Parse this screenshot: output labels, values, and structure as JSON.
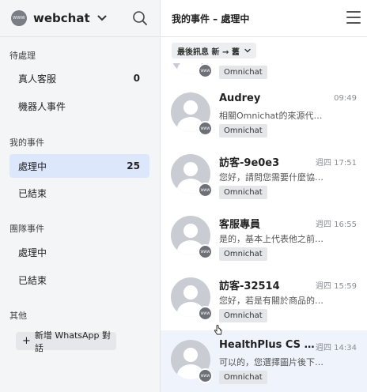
{
  "brand": {
    "logo_text": "WWW",
    "name": "webchat"
  },
  "sidebar": {
    "pending": {
      "title": "待處理",
      "items": [
        {
          "label": "真人客服",
          "count": "0"
        },
        {
          "label": "機器人事件",
          "count": ""
        }
      ]
    },
    "mine": {
      "title": "我的事件",
      "items": [
        {
          "label": "處理中",
          "count": "25",
          "active": true
        },
        {
          "label": "已結束",
          "count": ""
        }
      ]
    },
    "team": {
      "title": "團隊事件",
      "items": [
        {
          "label": "處理中",
          "count": ""
        },
        {
          "label": "已結束",
          "count": ""
        }
      ]
    },
    "other": {
      "title": "其他",
      "whatsapp_button": "新增 WhatsApp 對話"
    }
  },
  "main": {
    "title": "我的事件 – 處理中",
    "sort_label": "最後訊息 新 → 舊",
    "partial_item_tag": "Omnichat",
    "badge_text": "WWW",
    "conversations": [
      {
        "name": "Audrey",
        "time": "09:49",
        "message": "相關Omnichat的來源代…",
        "tag": "Omnichat"
      },
      {
        "name": "訪客-9e0e3",
        "time": "週四 17:51",
        "message": "您好，請問您需要什麼協…",
        "tag": "Omnichat"
      },
      {
        "name": "客服專員",
        "time": "週四 16:55",
        "message": "是的，基本上代表他之前…",
        "tag": "Omnichat"
      },
      {
        "name": "訪客-32514",
        "time": "週四 15:59",
        "message": "您好，若是有關於商品的…",
        "tag": "Omnichat"
      },
      {
        "name": "HealthPlus CS …",
        "time": "週四 14:34",
        "message": "可以的，您選擇圖片後下…",
        "tag": "Omnichat",
        "selected": true
      }
    ]
  },
  "icons": {
    "search": "search-icon",
    "menu": "hamburger-menu-icon",
    "chevron": "chevron-down-icon",
    "plus": "plus-icon"
  },
  "colors": {
    "sidebar_bg": "#f4f5f7",
    "active_item_bg": "#dce7fb",
    "selected_row_bg": "#eef3fc",
    "avatar_bg": "#c9ccd2",
    "tag_bg": "#e4e6ea"
  }
}
